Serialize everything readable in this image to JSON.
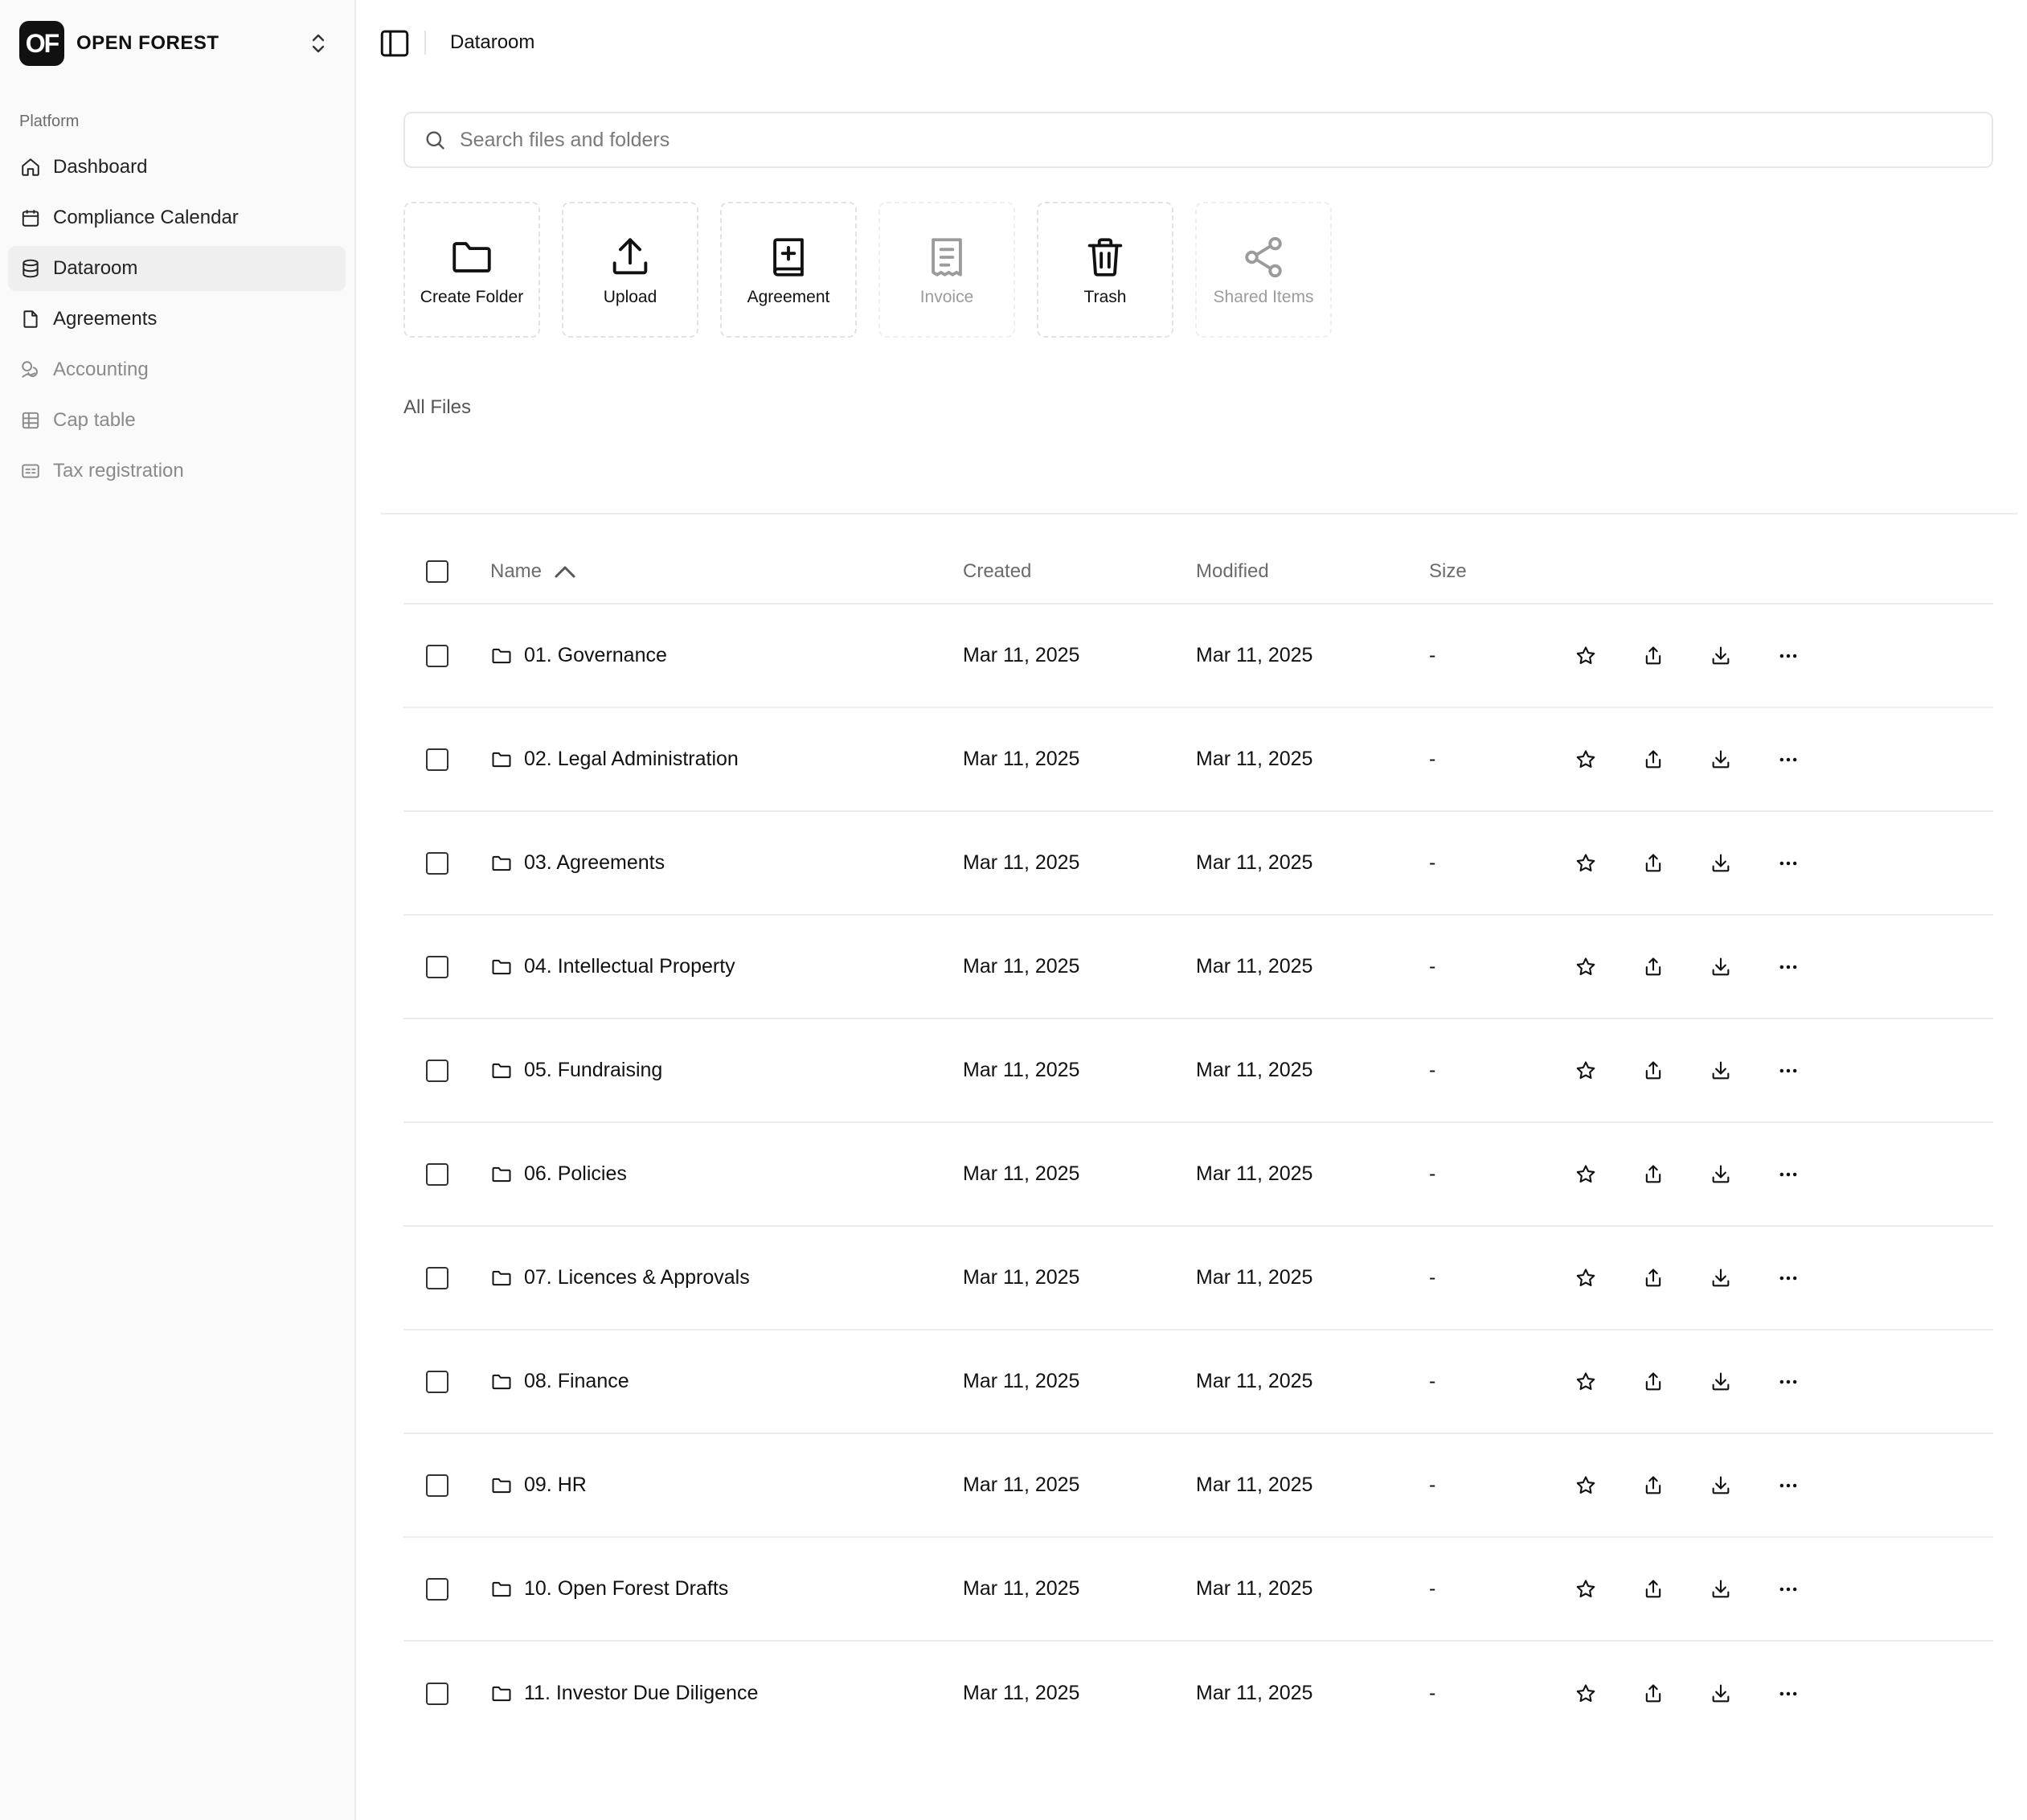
{
  "brand": {
    "logo_text": "OF",
    "name": "OPEN FOREST"
  },
  "sidebar": {
    "section_label": "Platform",
    "items": [
      {
        "label": "Dashboard",
        "icon": "home-icon",
        "state": "normal"
      },
      {
        "label": "Compliance Calendar",
        "icon": "calendar-icon",
        "state": "normal"
      },
      {
        "label": "Dataroom",
        "icon": "database-icon",
        "state": "active"
      },
      {
        "label": "Agreements",
        "icon": "file-icon",
        "state": "normal"
      },
      {
        "label": "Accounting",
        "icon": "coins-icon",
        "state": "disabled"
      },
      {
        "label": "Cap table",
        "icon": "table-icon",
        "state": "disabled"
      },
      {
        "label": "Tax registration",
        "icon": "id-card-icon",
        "state": "disabled"
      }
    ]
  },
  "header": {
    "title": "Dataroom"
  },
  "search": {
    "placeholder": "Search files and folders",
    "value": ""
  },
  "actions": [
    {
      "label": "Create Folder",
      "icon": "folder-icon",
      "disabled": false
    },
    {
      "label": "Upload",
      "icon": "upload-icon",
      "disabled": false
    },
    {
      "label": "Agreement",
      "icon": "book-plus-icon",
      "disabled": false
    },
    {
      "label": "Invoice",
      "icon": "receipt-icon",
      "disabled": true
    },
    {
      "label": "Trash",
      "icon": "trash-icon",
      "disabled": false
    },
    {
      "label": "Shared Items",
      "icon": "share-icon",
      "disabled": true
    }
  ],
  "breadcrumb": "All Files",
  "table": {
    "columns": {
      "name": "Name",
      "created": "Created",
      "modified": "Modified",
      "size": "Size"
    },
    "sort": {
      "column": "name",
      "direction": "ascending"
    },
    "rows": [
      {
        "name": "01. Governance",
        "created": "Mar 11, 2025",
        "modified": "Mar 11, 2025",
        "size": "-"
      },
      {
        "name": "02. Legal Administration",
        "created": "Mar 11, 2025",
        "modified": "Mar 11, 2025",
        "size": "-"
      },
      {
        "name": "03. Agreements",
        "created": "Mar 11, 2025",
        "modified": "Mar 11, 2025",
        "size": "-"
      },
      {
        "name": "04. Intellectual Property",
        "created": "Mar 11, 2025",
        "modified": "Mar 11, 2025",
        "size": "-"
      },
      {
        "name": "05. Fundraising",
        "created": "Mar 11, 2025",
        "modified": "Mar 11, 2025",
        "size": "-"
      },
      {
        "name": "06. Policies",
        "created": "Mar 11, 2025",
        "modified": "Mar 11, 2025",
        "size": "-"
      },
      {
        "name": "07. Licences & Approvals",
        "created": "Mar 11, 2025",
        "modified": "Mar 11, 2025",
        "size": "-"
      },
      {
        "name": "08. Finance",
        "created": "Mar 11, 2025",
        "modified": "Mar 11, 2025",
        "size": "-"
      },
      {
        "name": "09. HR",
        "created": "Mar 11, 2025",
        "modified": "Mar 11, 2025",
        "size": "-"
      },
      {
        "name": "10. Open Forest Drafts",
        "created": "Mar 11, 2025",
        "modified": "Mar 11, 2025",
        "size": "-"
      },
      {
        "name": "11. Investor Due Diligence",
        "created": "Mar 11, 2025",
        "modified": "Mar 11, 2025",
        "size": "-"
      }
    ]
  },
  "colors": {
    "text": "#111111",
    "muted": "#6b6b6b",
    "disabled": "#9b9b9b",
    "border": "#ececec",
    "sidebar_bg": "#fafafa",
    "active_bg": "#efefef"
  }
}
